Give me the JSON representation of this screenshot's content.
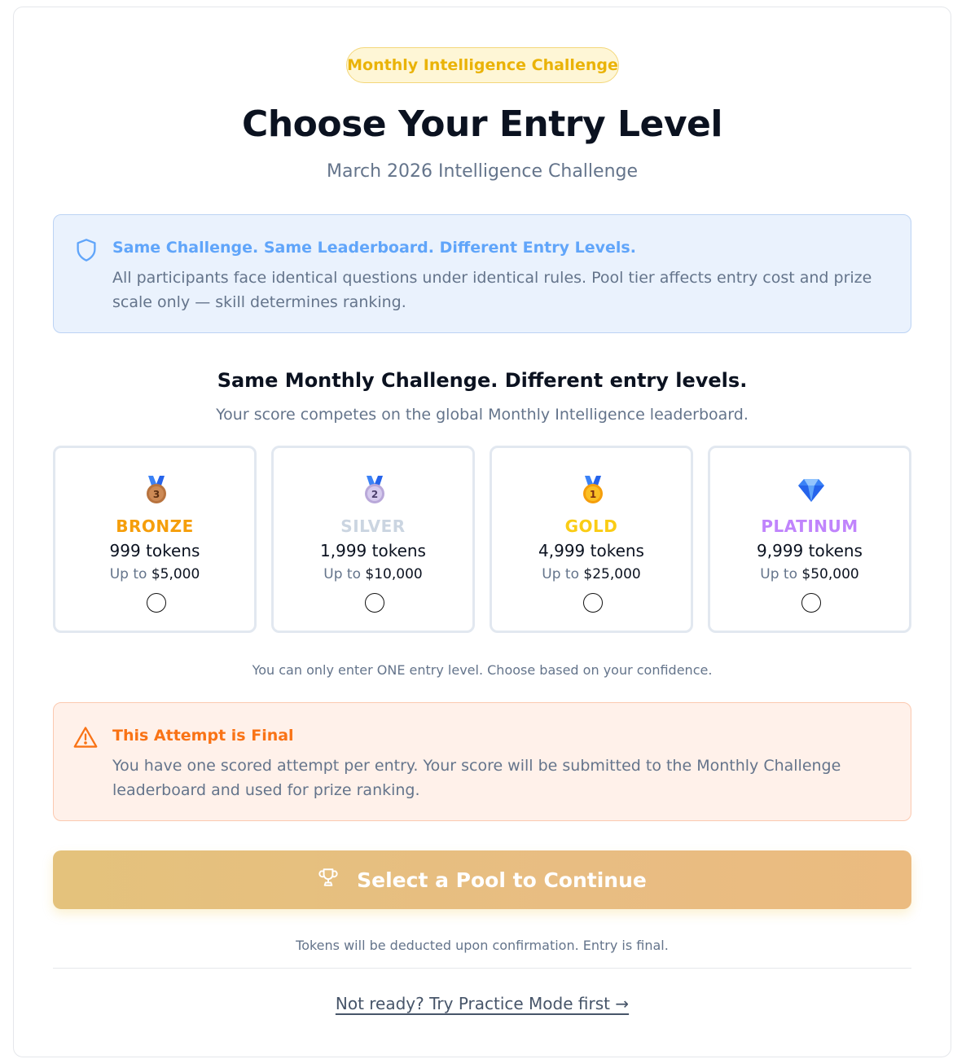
{
  "header": {
    "badge": "Monthly Intelligence Challenge",
    "title": "Choose Your Entry Level",
    "subtitle": "March 2026 Intelligence Challenge"
  },
  "info_box": {
    "icon": "shield-icon",
    "heading": "Same Challenge. Same Leaderboard. Different Entry Levels.",
    "body": "All participants face identical questions under identical rules. Pool tier affects entry cost and prize scale only — skill determines ranking."
  },
  "tiers_section": {
    "title": "Same Monthly Challenge. Different entry levels.",
    "subtitle": "Your score competes on the global Monthly Intelligence leaderboard.",
    "tiers": [
      {
        "icon": "bronze-medal-icon",
        "name": "BRONZE",
        "tokens": "999 tokens",
        "prize_label": "Up to",
        "prize_amount": "$5,000",
        "color": "#f59e0b",
        "selected": false
      },
      {
        "icon": "silver-medal-icon",
        "name": "SILVER",
        "tokens": "1,999 tokens",
        "prize_label": "Up to",
        "prize_amount": "$10,000",
        "color": "#cbd5e1",
        "selected": false
      },
      {
        "icon": "gold-medal-icon",
        "name": "GOLD",
        "tokens": "4,999 tokens",
        "prize_label": "Up to",
        "prize_amount": "$25,000",
        "color": "#facc15",
        "selected": false
      },
      {
        "icon": "diamond-icon",
        "name": "PLATINUM",
        "tokens": "9,999 tokens",
        "prize_label": "Up to",
        "prize_amount": "$50,000",
        "color": "#c084fc",
        "selected": false
      }
    ],
    "note": "You can only enter ONE entry level. Choose based on your confidence."
  },
  "warning_box": {
    "icon": "warning-triangle-icon",
    "heading": "This Attempt is Final",
    "body": "You have one scored attempt per entry. Your score will be submitted to the Monthly Challenge leaderboard and used for prize ranking."
  },
  "cta": {
    "icon": "trophy-icon",
    "label": "Select a Pool to Continue"
  },
  "footnote": "Tokens will be deducted upon confirmation. Entry is final.",
  "practice_link": "Not ready? Try Practice Mode first →",
  "colors": {
    "badge_text": "#eab308",
    "info_accent": "#60a5fa",
    "warning_accent": "#f97316",
    "cta_gradient_start": "#e4c27c",
    "cta_gradient_end": "#ebbb80"
  }
}
